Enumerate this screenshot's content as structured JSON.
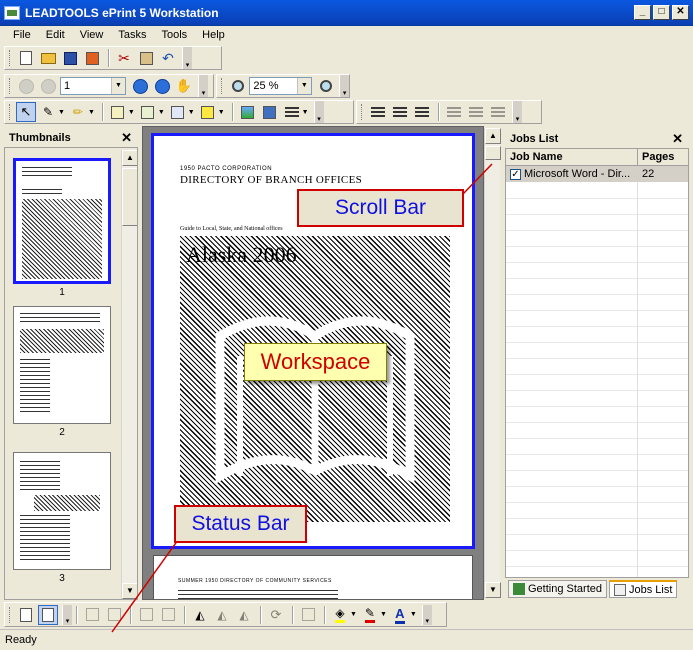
{
  "window": {
    "title": "LEADTOOLS ePrint 5 Workstation"
  },
  "menu": {
    "items": [
      "File",
      "Edit",
      "View",
      "Tasks",
      "Tools",
      "Help"
    ]
  },
  "nav_toolbar": {
    "page_value": "1",
    "zoom_value": "25 %"
  },
  "thumbnails": {
    "title": "Thumbnails",
    "pages": [
      {
        "label": "1"
      },
      {
        "label": "2"
      },
      {
        "label": "3"
      }
    ]
  },
  "document": {
    "org_line": "1950 PACTO CORPORATION",
    "heading": "DIRECTORY OF BRANCH OFFICES",
    "guide_line": "Guide to Local, State, and National offices",
    "cover_title": "Alaska 2006",
    "page2_header": "SUMMER 1950 DIRECTORY OF COMMUNITY SERVICES"
  },
  "jobs_list": {
    "title": "Jobs List",
    "columns": [
      "Job Name",
      "Pages"
    ],
    "rows": [
      {
        "name": "Microsoft Word - Dir...",
        "pages": "22",
        "checked": true
      }
    ]
  },
  "bottom_tabs": [
    "Getting Started",
    "Jobs List"
  ],
  "status": {
    "text": "Ready"
  },
  "callouts": {
    "scroll_bar": "Scroll Bar",
    "workspace": "Workspace",
    "status_bar": "Status Bar"
  },
  "colors": {
    "callout_border": "#d00000",
    "callout_text": "#1010e0",
    "selection_border": "#1a1aff",
    "titlebar": "#0a4bd0"
  }
}
